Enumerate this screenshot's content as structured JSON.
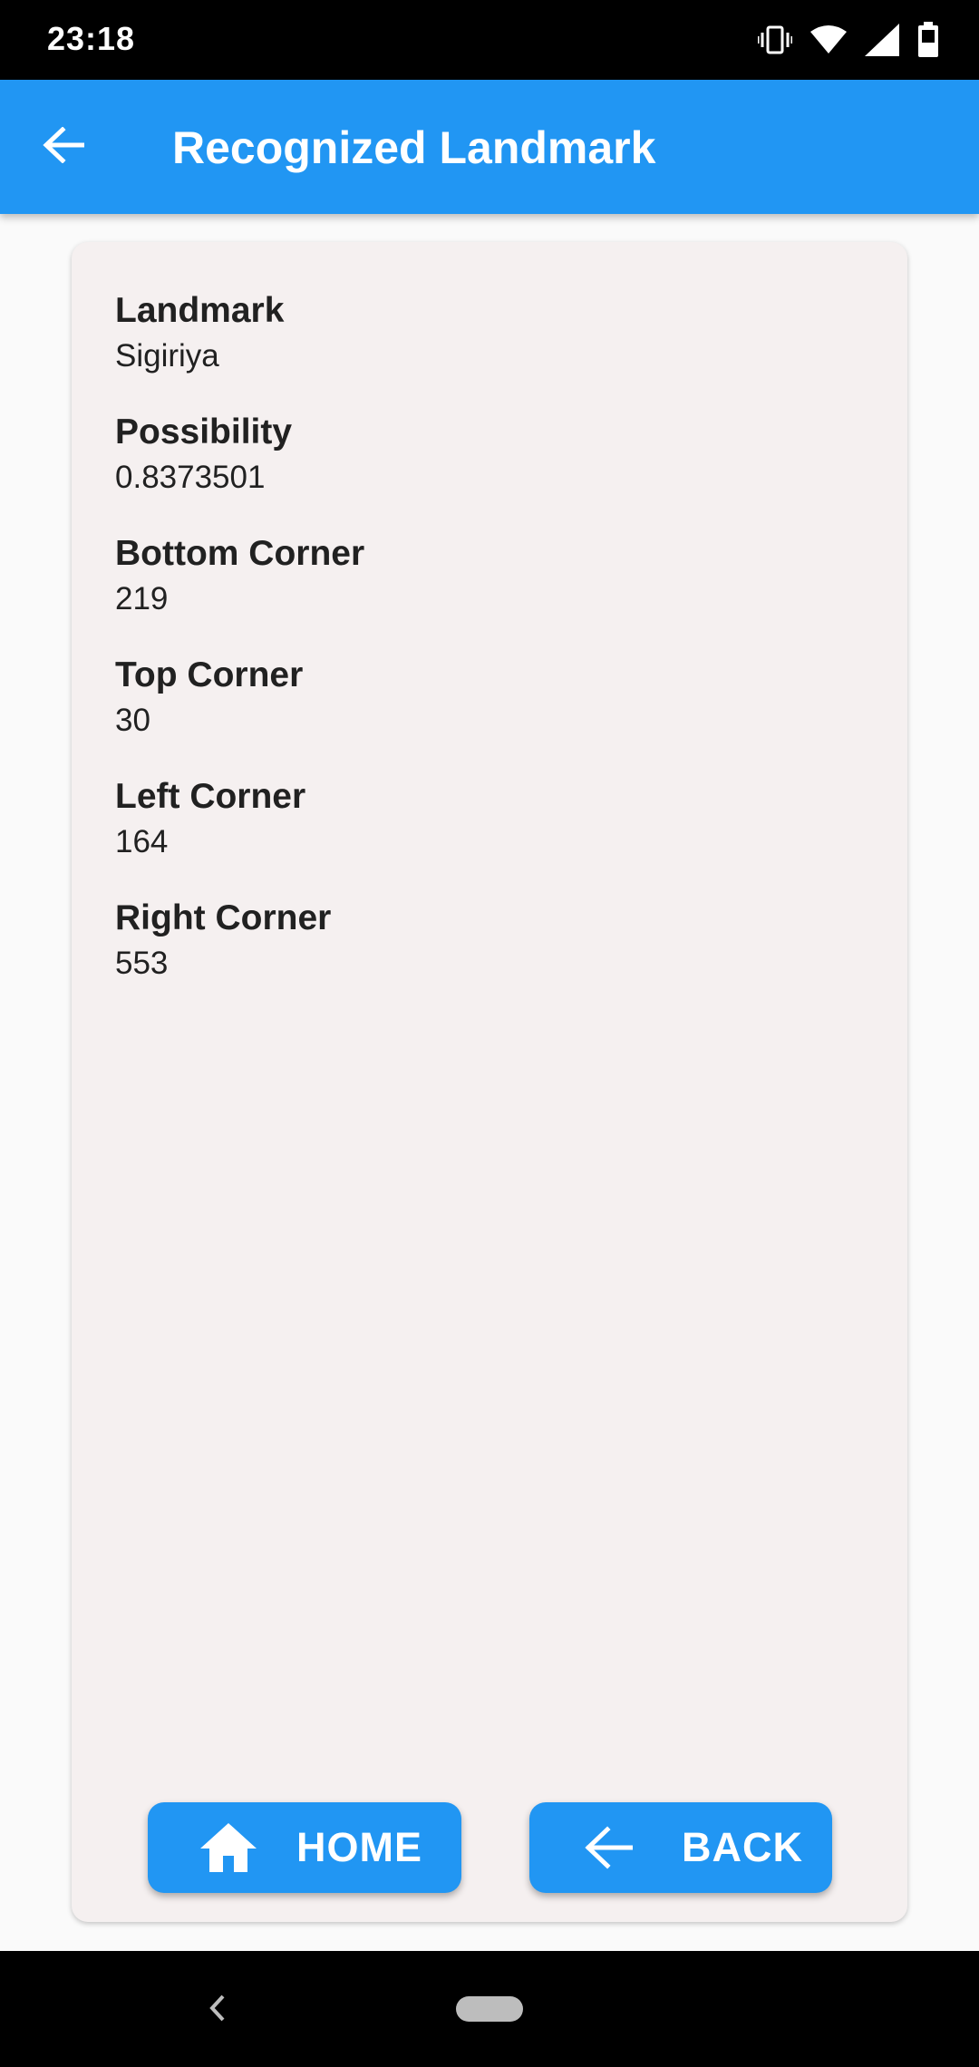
{
  "status_bar": {
    "time": "23:18",
    "icons": [
      "vibrate-icon",
      "wifi-icon",
      "signal-icon",
      "battery-icon"
    ]
  },
  "app_bar": {
    "title": "Recognized Landmark",
    "back_icon": "arrow-left-icon",
    "color": "#2196f3"
  },
  "fields": [
    {
      "label": "Landmark",
      "value": "Sigiriya"
    },
    {
      "label": "Possibility",
      "value": "0.8373501"
    },
    {
      "label": "Bottom Corner",
      "value": "219"
    },
    {
      "label": "Top Corner",
      "value": "30"
    },
    {
      "label": "Left Corner",
      "value": "164"
    },
    {
      "label": "Right Corner",
      "value": "553"
    }
  ],
  "buttons": {
    "home": {
      "label": "HOME",
      "icon": "home-icon"
    },
    "back": {
      "label": "BACK",
      "icon": "arrow-left-icon"
    }
  },
  "nav_bar": {
    "icons": [
      "nav-back-icon",
      "nav-home-pill"
    ]
  }
}
